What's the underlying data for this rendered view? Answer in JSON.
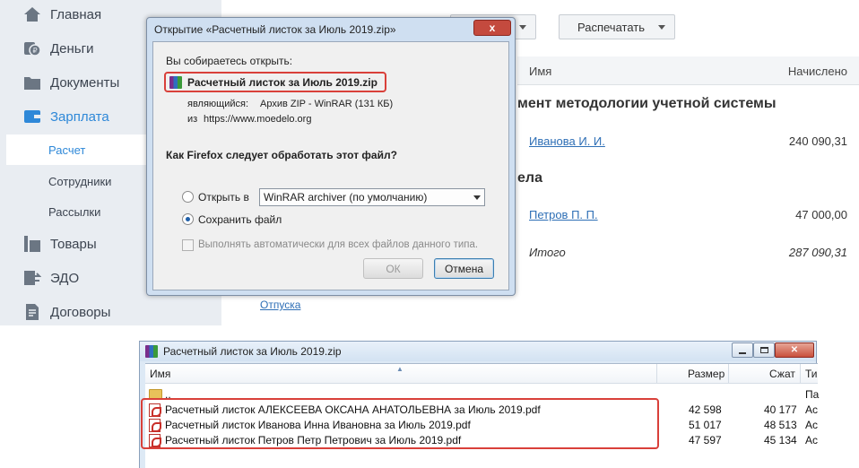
{
  "sidebar": {
    "items": [
      {
        "label": "Главная",
        "icon": "home-icon"
      },
      {
        "label": "Деньги",
        "icon": "money-icon"
      },
      {
        "label": "Документы",
        "icon": "folder-icon"
      },
      {
        "label": "Зарплата",
        "icon": "wallet-icon"
      },
      {
        "label": "Товары",
        "icon": "boxes-icon"
      },
      {
        "label": "ЭДО",
        "icon": "exchange-icon"
      },
      {
        "label": "Договоры",
        "icon": "contract-icon"
      }
    ],
    "sub_items": [
      {
        "label": "Расчет"
      },
      {
        "label": "Сотрудники"
      },
      {
        "label": "Рассылки"
      }
    ],
    "accent_color": "#2e88d8"
  },
  "main": {
    "print_button": "Распечатать",
    "columns": {
      "name": "Имя",
      "accrued": "Начислено"
    },
    "departments": [
      {
        "title": "мент методологии учетной системы",
        "employee": "Иванова И. И.",
        "amount": "240 090,31"
      },
      {
        "title": "ела",
        "employee": "Петров П. П.",
        "amount": "47 000,00"
      }
    ],
    "total_label": "Итого",
    "total_amount": "287 090,31",
    "vacation_link": "Отпуска"
  },
  "ff_dialog": {
    "title": "Открытие «Расчетный листок за Июль 2019.zip»",
    "close_label": "x",
    "intro": "Вы собираетесь открыть:",
    "file_name": "Расчетный листок за Июль 2019.zip",
    "type_label": "являющийся:",
    "type_value": "Архив ZIP - WinRAR (131 КБ)",
    "from_label": "из",
    "from_value": "https://www.moedelo.org",
    "question": "Как Firefox следует обработать этот файл?",
    "open_with_label": "Открыть в",
    "open_with_value": "WinRAR archiver (по умолчанию)",
    "save_label": "Сохранить файл",
    "selected_option": "save",
    "auto_label": "Выполнять автоматически для всех файлов данного типа.",
    "ok_label": "ОК",
    "cancel_label": "Отмена"
  },
  "rar_window": {
    "title": "Расчетный листок за Июль 2019.zip",
    "columns": {
      "name": "Имя",
      "size": "Размер",
      "packed": "Сжат",
      "type": "Ти"
    },
    "rows": [
      {
        "name": "..",
        "size": "",
        "packed": "",
        "type": "Па",
        "icon": "folder-icon"
      },
      {
        "name": "Расчетный листок АЛЕКСЕЕВА ОКСАНА АНАТОЛЬЕВНА за Июль 2019.pdf",
        "size": "42 598",
        "packed": "40 177",
        "type": "Ac",
        "icon": "pdf-icon"
      },
      {
        "name": "Расчетный листок Иванова Инна Ивановна за Июль 2019.pdf",
        "size": "51 017",
        "packed": "48 513",
        "type": "Ac",
        "icon": "pdf-icon"
      },
      {
        "name": "Расчетный листок Петров Петр Петрович за Июль 2019.pdf",
        "size": "47 597",
        "packed": "45 134",
        "type": "Ac",
        "icon": "pdf-icon"
      }
    ]
  },
  "highlight_color": "#d9403a"
}
